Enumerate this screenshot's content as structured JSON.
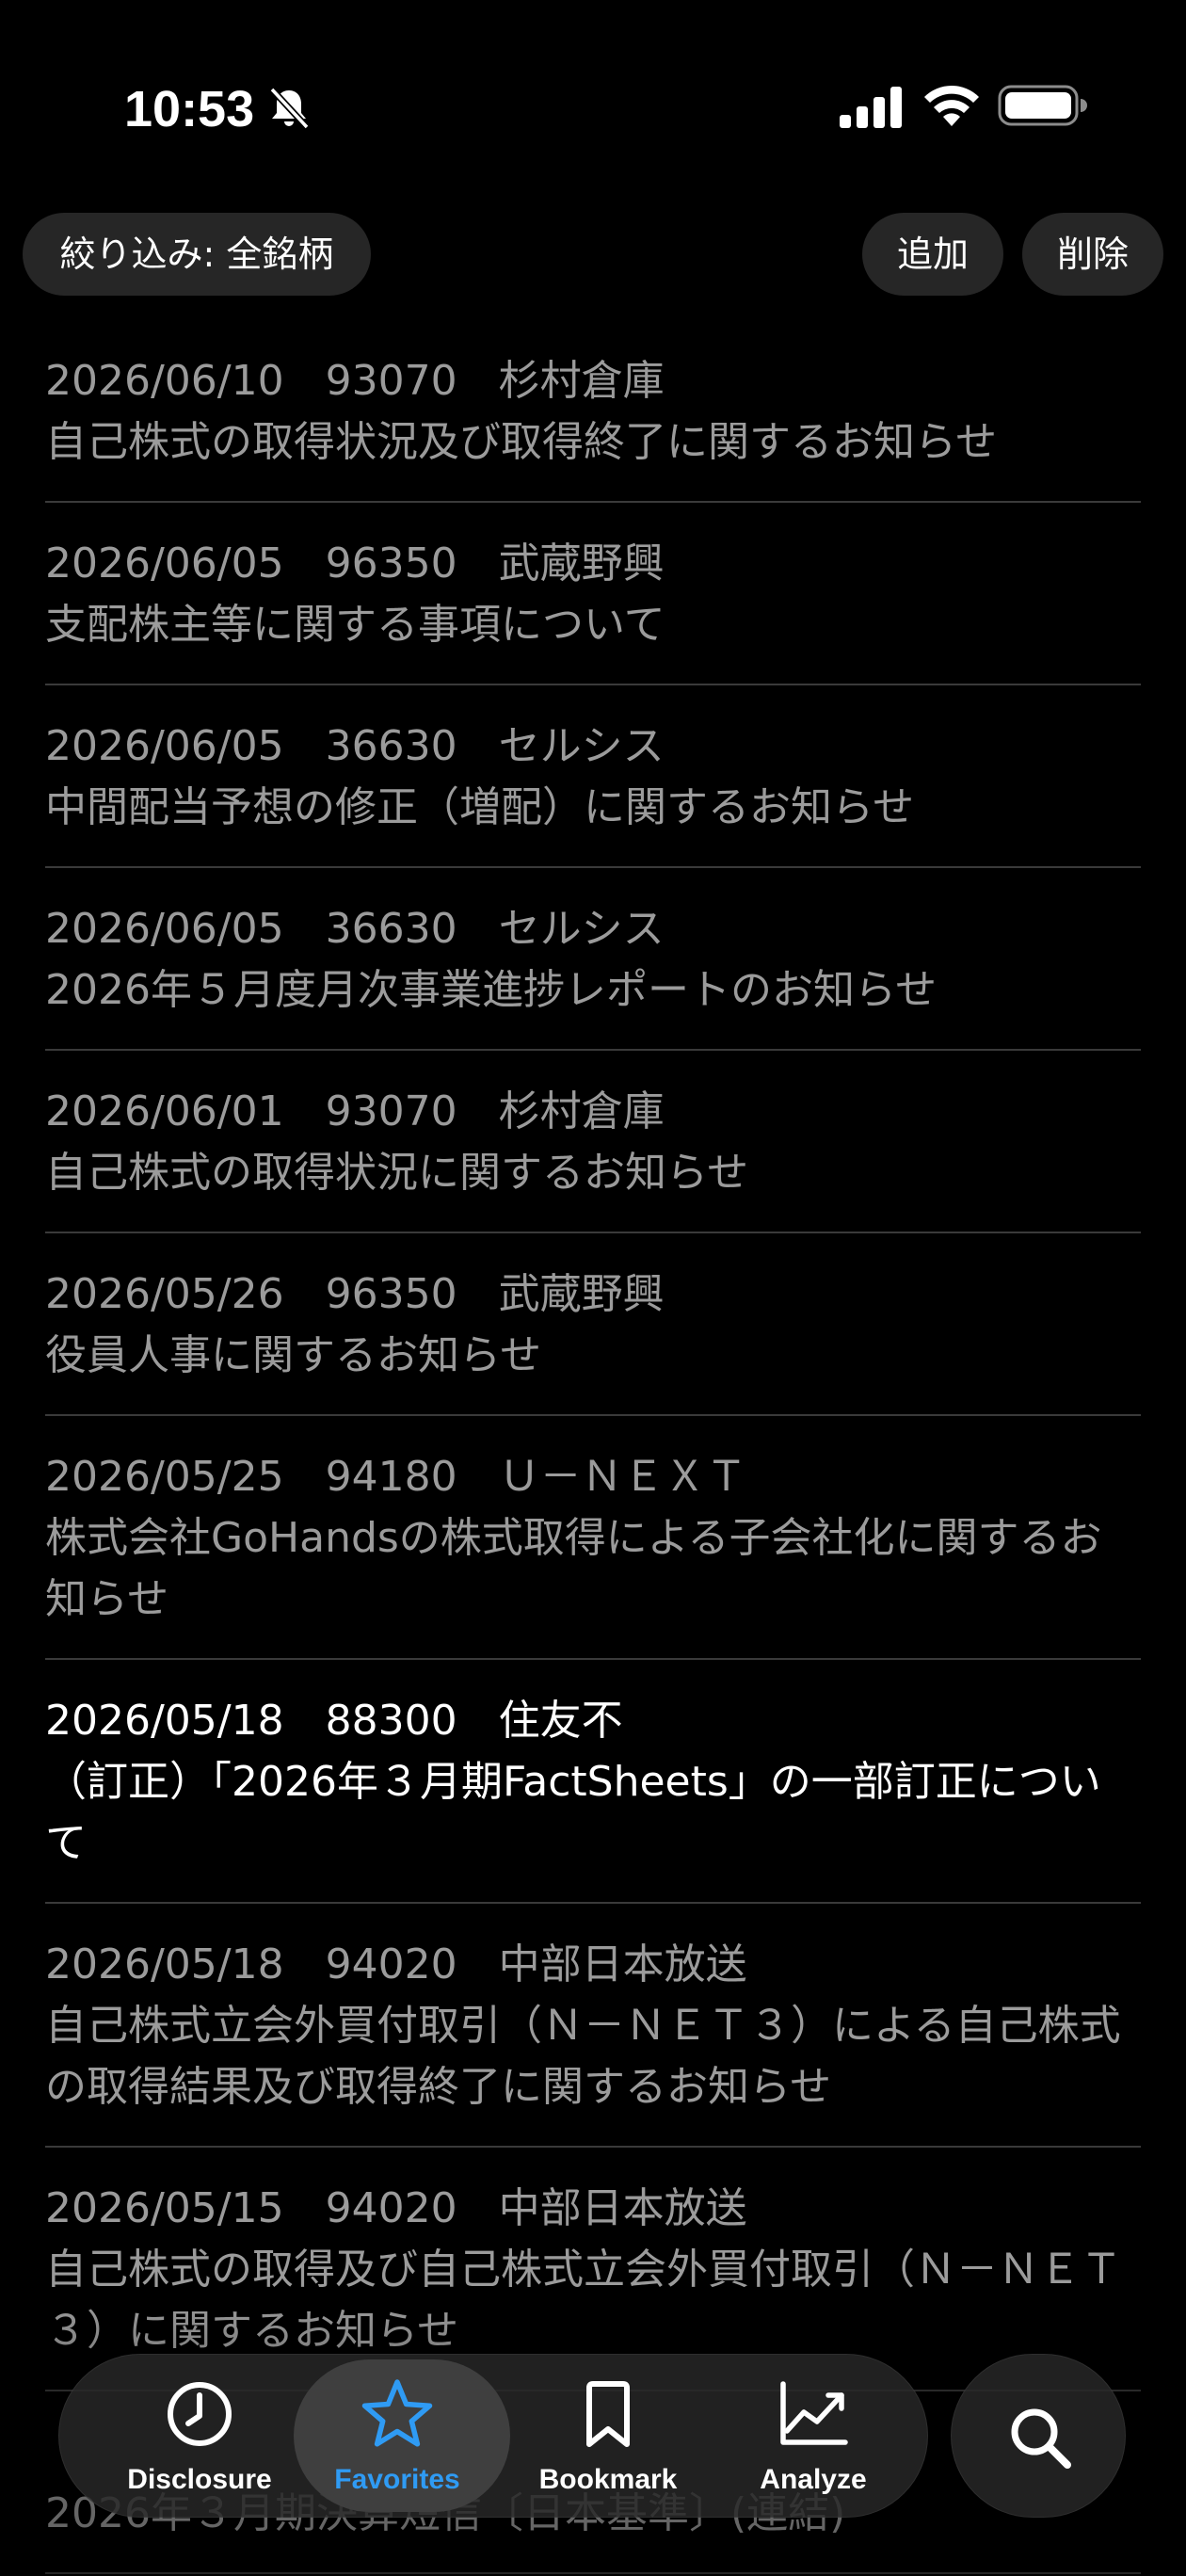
{
  "status_bar": {
    "time": "10:53"
  },
  "toolbar": {
    "filter_label": "絞り込み: 全銘柄",
    "add_label": "追加",
    "delete_label": "削除"
  },
  "disclosures": [
    {
      "date": "2026/06/10",
      "code": "93070",
      "company": "杉村倉庫",
      "title": "自己株式の取得状況及び取得終了に関するお知らせ",
      "read": true
    },
    {
      "date": "2026/06/05",
      "code": "96350",
      "company": "武蔵野興",
      "title": "支配株主等に関する事項について",
      "read": true
    },
    {
      "date": "2026/06/05",
      "code": "36630",
      "company": "セルシス",
      "title": "中間配当予想の修正（増配）に関するお知らせ",
      "read": true
    },
    {
      "date": "2026/06/05",
      "code": "36630",
      "company": "セルシス",
      "title": "2026年５月度月次事業進捗レポートのお知らせ",
      "read": true
    },
    {
      "date": "2026/06/01",
      "code": "93070",
      "company": "杉村倉庫",
      "title": "自己株式の取得状況に関するお知らせ",
      "read": true
    },
    {
      "date": "2026/05/26",
      "code": "96350",
      "company": "武蔵野興",
      "title": "役員人事に関するお知らせ",
      "read": true
    },
    {
      "date": "2026/05/25",
      "code": "94180",
      "company": "Ｕ－ＮＥＸＴ",
      "title": "株式会社GoHandsの株式取得による子会社化に関するお知らせ",
      "read": true
    },
    {
      "date": "2026/05/18",
      "code": "88300",
      "company": "住友不",
      "title": "（訂正）「2026年３月期FactSheets」の一部訂正について",
      "read": false
    },
    {
      "date": "2026/05/18",
      "code": "94020",
      "company": "中部日本放送",
      "title": "自己株式立会外買付取引（Ｎ－ＮＥＴ３）による自己株式の取得結果及び取得終了に関するお知らせ",
      "read": true
    },
    {
      "date": "2026/05/15",
      "code": "94020",
      "company": "中部日本放送",
      "title": "自己株式の取得及び自己株式立会外買付取引（Ｎ－ＮＥＴ３）に関するお知らせ",
      "read": true
    },
    {
      "date": "",
      "code": "",
      "company": "",
      "title": "2026年３月期決算短信〔日本基準〕(連結)",
      "read": true
    }
  ],
  "tab_bar": {
    "tabs": [
      {
        "label": "Disclosure",
        "icon": "clock-icon"
      },
      {
        "label": "Favorites",
        "icon": "star-icon",
        "active": true
      },
      {
        "label": "Bookmark",
        "icon": "bookmark-icon"
      },
      {
        "label": "Analyze",
        "icon": "chart-icon"
      }
    ],
    "search_icon": "search-icon",
    "accent_color": "#2f9bf4"
  }
}
